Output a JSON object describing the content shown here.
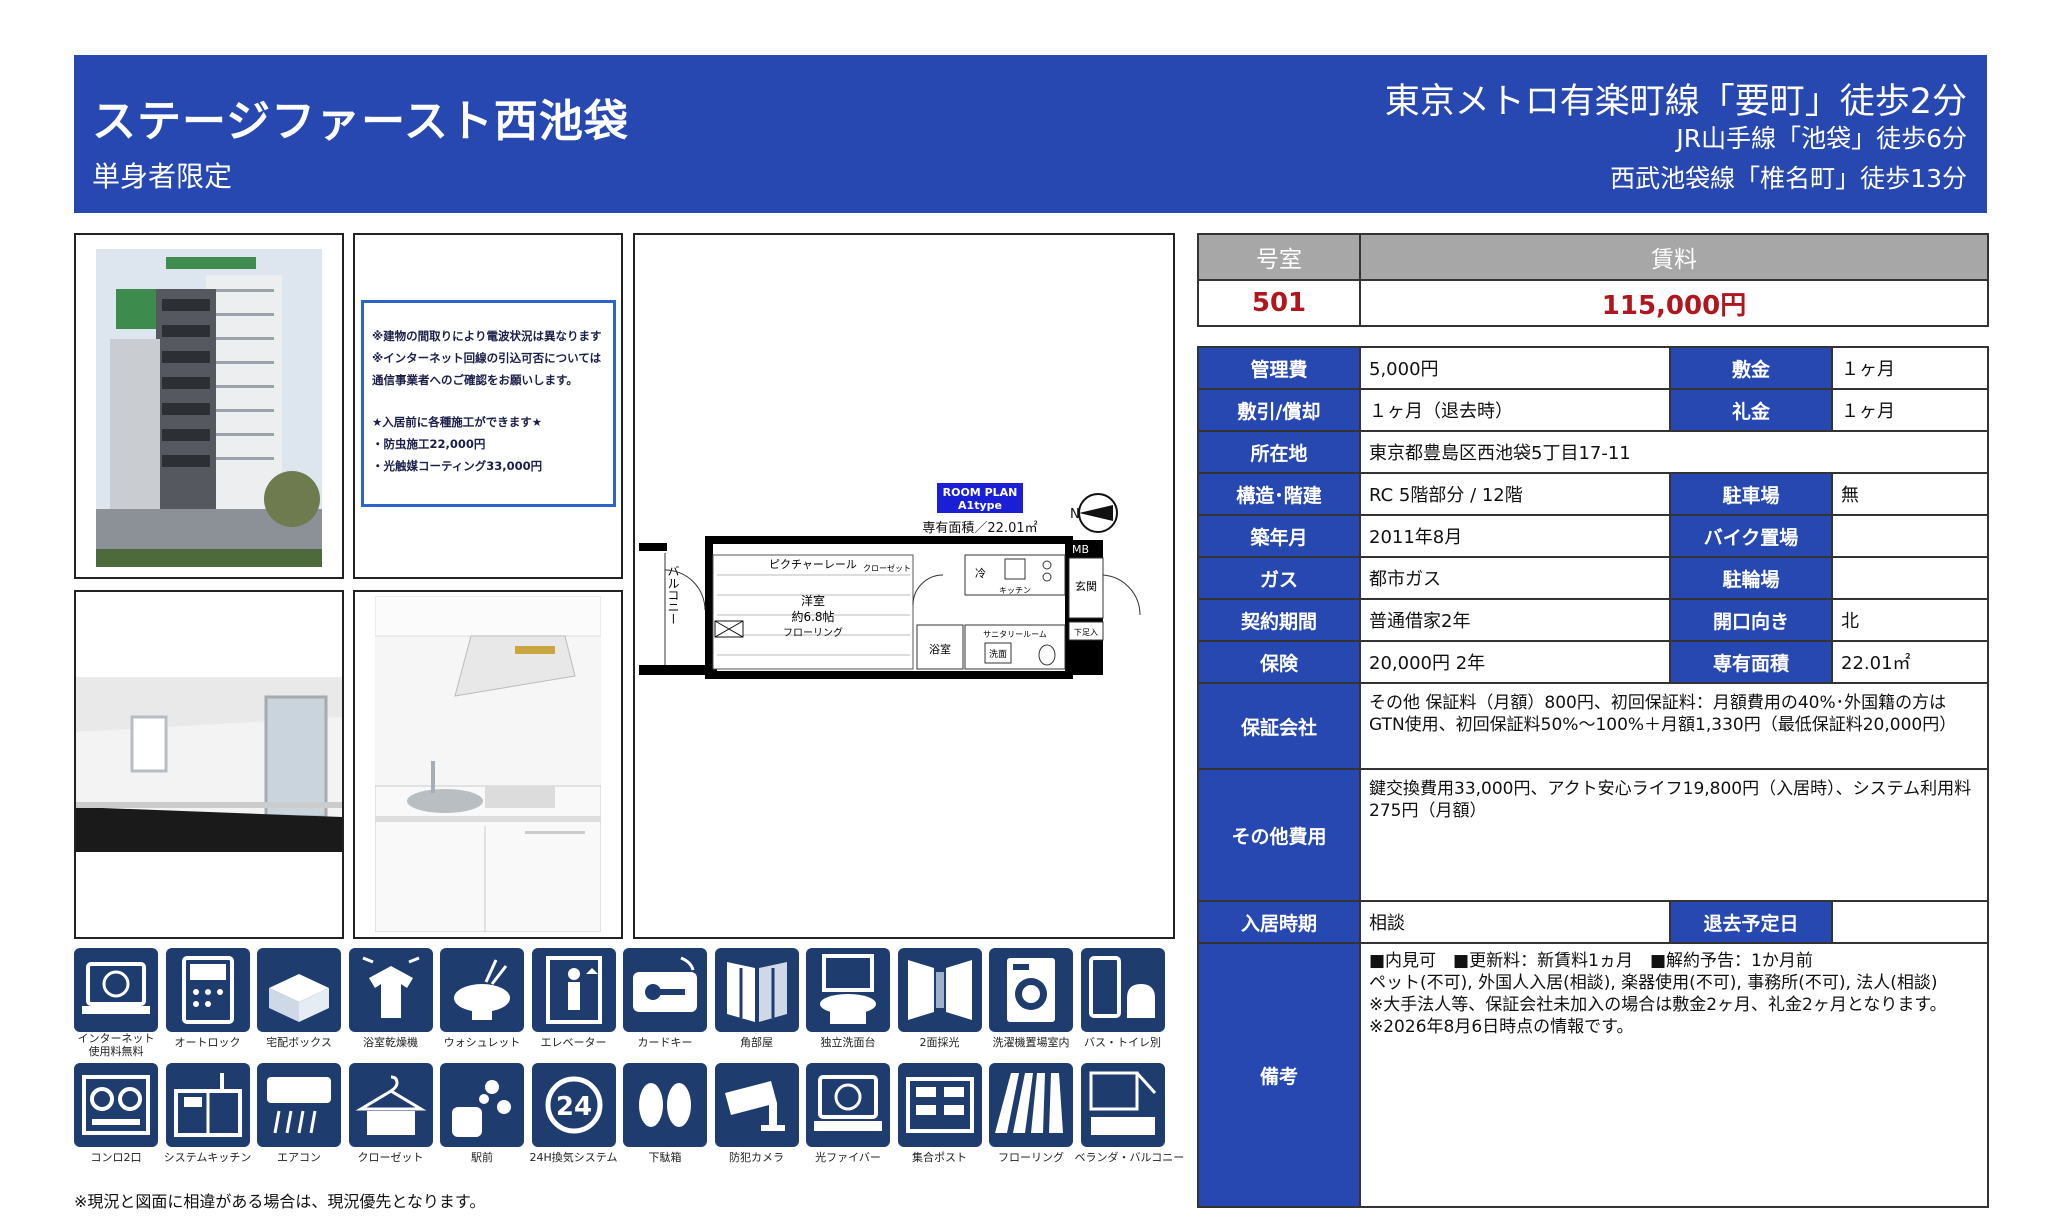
{
  "header": {
    "property_name": "ステージファースト西池袋",
    "subtitle": "単身者限定",
    "station_main": "東京メトロ有楽町線「要町」徒歩2分",
    "station_2": "JR山手線「池袋」徒歩6分",
    "station_3": "西武池袋線「椎名町」徒歩13分"
  },
  "notice": {
    "lines": [
      "※建物の間取りにより電波状況は異なります",
      "※インターネット回線の引込可否については",
      "通信事業者へのご確認をお願いします。",
      "★入居前に各種施工ができます★",
      "・防虫施工22,000円",
      "・光触媒コーティング33,000円"
    ]
  },
  "plan": {
    "badge_line1": "ROOM PLAN",
    "badge_line2": "A1type",
    "area": "専有面積／22.01㎡",
    "picture_rail": "ピクチャーレール",
    "closet": "クローゼット",
    "western_room": "洋室",
    "western_size": "約6.8帖",
    "flooring": "フローリング",
    "balcony": "バルコニー",
    "fridge": "冷",
    "kitchen": "キッチン",
    "entrance": "玄関",
    "mb": "MB",
    "bath": "浴室",
    "sanitary": "サニタリールーム",
    "washer": "洗面",
    "shoes": "下足入"
  },
  "icons": [
    {
      "name": "internet-icon",
      "label": "インターネット\n使用料無料"
    },
    {
      "name": "autolock-icon",
      "label": "オートロック"
    },
    {
      "name": "delivery-box-icon",
      "label": "宅配ボックス"
    },
    {
      "name": "bath-dryer-icon",
      "label": "浴室乾燥機"
    },
    {
      "name": "washlet-icon",
      "label": "ウォシュレット"
    },
    {
      "name": "elevator-icon",
      "label": "エレベーター"
    },
    {
      "name": "card-key-icon",
      "label": "カードキー"
    },
    {
      "name": "corner-room-icon",
      "label": "角部屋"
    },
    {
      "name": "vanity-icon",
      "label": "独立洗面台"
    },
    {
      "name": "two-side-light-icon",
      "label": "2面採光"
    },
    {
      "name": "washer-space-icon",
      "label": "洗濯機置場室内"
    },
    {
      "name": "bath-toilet-separate-icon",
      "label": "バス・トイレ別"
    },
    {
      "name": "two-burner-stove-icon",
      "label": "コンロ2口"
    },
    {
      "name": "system-kitchen-icon",
      "label": "システムキッチン"
    },
    {
      "name": "air-conditioner-icon",
      "label": "エアコン"
    },
    {
      "name": "closet-icon",
      "label": "クローゼット"
    },
    {
      "name": "station-near-icon",
      "label": "駅前"
    },
    {
      "name": "ventilation-24h-icon",
      "label": "24H換気システム"
    },
    {
      "name": "shoe-box-icon",
      "label": "下駄箱"
    },
    {
      "name": "security-camera-icon",
      "label": "防犯カメラ"
    },
    {
      "name": "fiber-icon",
      "label": "光ファイバー"
    },
    {
      "name": "mailbox-icon",
      "label": "集合ポスト"
    },
    {
      "name": "flooring-icon",
      "label": "フローリング"
    },
    {
      "name": "veranda-icon",
      "label": "ベランダ・バルコニー"
    }
  ],
  "footnote": "※現況と図面に相違がある場合は、現況優先となります。",
  "rent": {
    "room_label": "号室",
    "rent_label": "賃料",
    "room_value": "501",
    "rent_value": "115,000円"
  },
  "info": {
    "mgmt_label": "管理費",
    "mgmt_value": "5,000円",
    "deposit_label": "敷金",
    "deposit_value": "１ヶ月",
    "shikibiki_label": "敷引/償却",
    "shikibiki_value": "１ヶ月（退去時）",
    "keymoney_label": "礼金",
    "keymoney_value": "１ヶ月",
    "address_label": "所在地",
    "address_value": "東京都豊島区西池袋5丁目17-11",
    "structure_label": "構造･階建",
    "structure_value": "RC 5階部分 / 12階",
    "parking_label": "駐車場",
    "parking_value": "無",
    "built_label": "築年月",
    "built_value": "2011年8月",
    "bike_label": "バイク置場",
    "bike_value": "",
    "gas_label": "ガス",
    "gas_value": "都市ガス",
    "bicycle_label": "駐輪場",
    "bicycle_value": "",
    "contract_label": "契約期間",
    "contract_value": "普通借家2年",
    "facing_label": "開口向き",
    "facing_value": "北",
    "insurance_label": "保険",
    "insurance_value": "20,000円 2年",
    "area_label": "専有面積",
    "area_value": "22.01㎡",
    "guarantor_label": "保証会社",
    "guarantor_value": "その他 保証料（月額）800円、初回保証料：月額費用の40%･外国籍の方はGTN使用、初回保証料50%～100%＋月額1,330円（最低保証料20,000円）",
    "other_fees_label": "その他費用",
    "other_fees_value": "鍵交換費用33,000円、アクト安心ライフ19,800円（入居時）、システム利用料275円（月額）",
    "movein_label": "入居時期",
    "movein_value": "相談",
    "moveout_label": "退去予定日",
    "moveout_value": "",
    "remarks_label": "備考",
    "remarks_lines": [
      "■内見可　■更新料：新賃料1ヵ月　■解約予告：1か月前",
      "ペット(不可), 外国人入居(相談), 楽器使用(不可), 事務所(不可), 法人(相談)",
      "※大手法人等、保証会社未加入の場合は敷金2ヶ月、礼金2ヶ月となります。",
      "※2026年8月6日時点の情報です。"
    ]
  }
}
